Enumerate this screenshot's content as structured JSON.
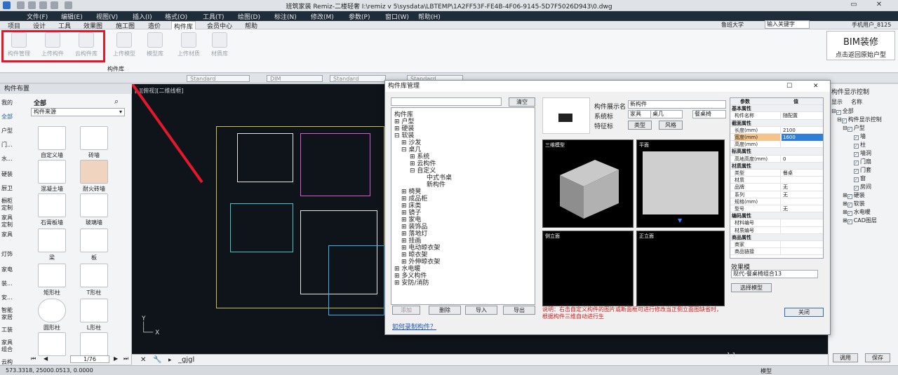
{
  "title_bar": {
    "title": "班筑家装 Remiz-二楼轻奢    I:\\remiz v 5\\sysdata\\LBTEMP\\1A2FF53F-FE4B-4F06-9145-5D7F5026D943\\0.dwg"
  },
  "menu": [
    "文件(F)",
    "编辑(E)",
    "视图(V)",
    "插入(I)",
    "格式(O)",
    "工具(T)",
    "绘图(D)",
    "标注(N)",
    "修改(M)",
    "参数(P)",
    "窗口(W)",
    "帮助(H)"
  ],
  "tabs": [
    "项目",
    "设计",
    "工具",
    "效果图",
    "施工图",
    "造价",
    "构件库",
    "会员中心",
    "帮助"
  ],
  "ribbon": {
    "buttons": [
      "构件管理",
      "上传构件",
      "云构件库",
      "上传模型",
      "模型库",
      "上传材质",
      "材质库"
    ],
    "group_label": "构件库",
    "user": "鲁班大学",
    "search_placeholder": "输入关键字",
    "phone_user": "手机用户_8125",
    "bim_title": "BIM装修",
    "bim_sub": "点击返回原始户型"
  },
  "toolstrip": {
    "styles": [
      "Standard",
      "DIM",
      "Standard",
      "Standard"
    ]
  },
  "left_panel": {
    "title": "构件布置",
    "categories": [
      "我的",
      "全部",
      "户型",
      "门...",
      "水...",
      "硬装",
      "厨卫",
      "橱柜定制",
      "家具定制",
      "家具",
      "灯饰",
      "家电",
      "装...",
      "安...",
      "智能家居",
      "工装",
      "家具组合",
      "云构"
    ],
    "all_label": "全部",
    "source_dropdown": "构件来源",
    "items": [
      "自定义墙",
      "砖墙",
      "混凝土墙",
      "耐火砖墙",
      "石膏板墙",
      "玻璃墙",
      "梁",
      "板",
      "矩形柱",
      "T形柱",
      "圆形柱",
      "L形柱",
      "",
      ""
    ],
    "page": "1/76"
  },
  "canvas": {
    "view_label": "[-][俯视][二维线框]"
  },
  "command": {
    "text": "_gjgl"
  },
  "status": {
    "coords": "573.3318,    25000.0513,   0.0000",
    "scale": "1:1",
    "model": "模型"
  },
  "right_panel": {
    "title": "构件显示控制",
    "col1": "显示",
    "col2": "名称",
    "tree": [
      "全部",
      "构件显示控制",
      "户型",
      "墙",
      "柱",
      "墙洞",
      "门扇",
      "门套",
      "窗",
      "房间",
      "硬装",
      "软装",
      "水电暖",
      "CAD图层"
    ],
    "apply": "调用",
    "save": "保存"
  },
  "dialog": {
    "title": "构件库管理",
    "clear_btn": "清空",
    "tree": [
      "构件库",
      "户型",
      "硬装",
      "软装",
      "沙发",
      "桌几",
      "系统",
      "云构件",
      "自定义",
      "中式书桌",
      "新构件",
      "椅凳",
      "成品柜",
      "床类",
      "镜子",
      "家电",
      "装饰品",
      "落地灯",
      "挂画",
      "电动晾衣架",
      "晾衣架",
      "外伸晾衣架",
      "水电暖",
      "多义构件",
      "安防/消防"
    ],
    "add_btn": "添加",
    "delete_btn": "删除",
    "import_btn": "导入",
    "export_btn": "导出",
    "record_link": "如何录制构件？",
    "display_name_label": "构件展示名",
    "display_name_value": "新构件",
    "tags_label": "系统标",
    "tag1": "家具",
    "tag2": "桌几",
    "tag3": "餐桌椅",
    "feature_label": "特征标",
    "type_btn": "类型",
    "style_btn": "风格",
    "views": [
      "三维模型",
      "平面",
      "侧立面",
      "正立面"
    ],
    "note": "说明：右击自定义构件的图片或断面框可进行修改当正侧立面图缺省时，根据构件三维自动进行生",
    "props_header": [
      "参数",
      "值"
    ],
    "props": [
      {
        "k": "基本属性",
        "v": "",
        "g": true
      },
      {
        "k": "构件名称",
        "v": "随配置"
      },
      {
        "k": "截面属性",
        "v": "",
        "g": true
      },
      {
        "k": "长度(mm)",
        "v": "2100"
      },
      {
        "k": "宽度(mm)",
        "v": "1600",
        "sel": true
      },
      {
        "k": "高度(mm)",
        "v": ""
      },
      {
        "k": "标高属性",
        "v": "",
        "g": true
      },
      {
        "k": "高地高度(mm)",
        "v": "0"
      },
      {
        "k": "材质属性",
        "v": "",
        "g": true
      },
      {
        "k": "类型",
        "v": "餐桌"
      },
      {
        "k": "材质",
        "v": ""
      },
      {
        "k": "品牌",
        "v": "无"
      },
      {
        "k": "系列",
        "v": "无"
      },
      {
        "k": "规格(mm)",
        "v": ""
      },
      {
        "k": "型号",
        "v": "无"
      },
      {
        "k": "编码属性",
        "v": "",
        "g": true
      },
      {
        "k": "材料编号",
        "v": ""
      },
      {
        "k": "材质编号",
        "v": ""
      },
      {
        "k": "商品属性",
        "v": "",
        "g": true
      },
      {
        "k": "商家",
        "v": ""
      },
      {
        "k": "商品链接",
        "v": ""
      }
    ],
    "effect_label": "效果模",
    "effect_value": "现代-餐桌椅组合13",
    "select_model_btn": "选择模型",
    "close_btn": "关闭"
  },
  "colors": {
    "accent_red": "#e3182d",
    "menubar": "#1f2c3a",
    "canvas": "#0f141a"
  }
}
